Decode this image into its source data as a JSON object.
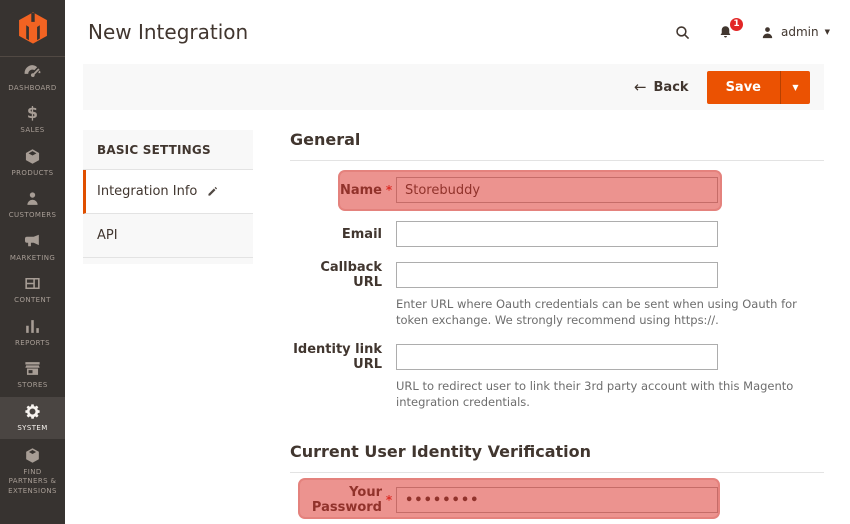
{
  "header": {
    "title": "New Integration",
    "user_name": "admin",
    "notification_count": "1"
  },
  "toolbar": {
    "back_label": "Back",
    "save_label": "Save"
  },
  "sidebar": {
    "items": [
      {
        "label": "DASHBOARD",
        "icon": "dashboard"
      },
      {
        "label": "SALES",
        "icon": "sales"
      },
      {
        "label": "PRODUCTS",
        "icon": "products"
      },
      {
        "label": "CUSTOMERS",
        "icon": "customers"
      },
      {
        "label": "MARKETING",
        "icon": "marketing"
      },
      {
        "label": "CONTENT",
        "icon": "content"
      },
      {
        "label": "REPORTS",
        "icon": "reports"
      },
      {
        "label": "STORES",
        "icon": "stores"
      },
      {
        "label": "SYSTEM",
        "icon": "system",
        "active": true
      },
      {
        "label": "FIND PARTNERS & EXTENSIONS",
        "icon": "find-partners"
      }
    ]
  },
  "tabs_panel": {
    "header": "BASIC SETTINGS",
    "items": [
      {
        "label": "Integration Info",
        "active": true
      },
      {
        "label": "API",
        "active": false
      }
    ]
  },
  "form": {
    "section1_title": "General",
    "name_label": "Name",
    "name_value": "Storebuddy",
    "email_label": "Email",
    "callback_label": "Callback URL",
    "callback_note": "Enter URL where Oauth credentials can be sent when using Oauth for token exchange. We strongly recommend using https://.",
    "identity_label": "Identity link URL",
    "identity_note": "URL to redirect user to link their 3rd party account with this Magento integration credentials.",
    "section2_title": "Current User Identity Verification",
    "password_label": "Your Password",
    "password_value": "••••••••",
    "required_marker": "*"
  },
  "colors": {
    "accent_orange": "#eb5202",
    "logo_orange": "#f26322",
    "sidebar_bg": "#373330",
    "badge_red": "#e22626",
    "highlight_red": "#e98f88"
  }
}
